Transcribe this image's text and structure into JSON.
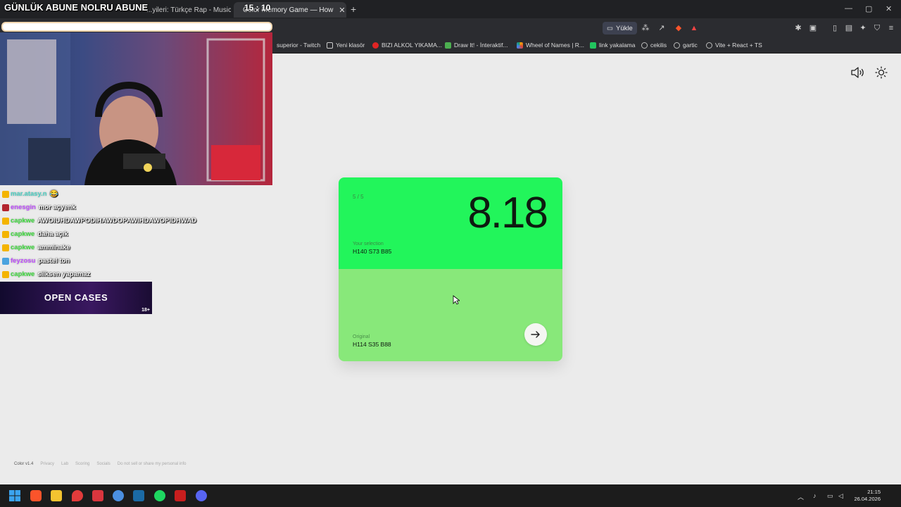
{
  "browser": {
    "tabs": [
      {
        "label": "...yileri: Türkçe Rap - Music Quiz - (",
        "active": false
      },
      {
        "label": "Color Memory Game — How",
        "active": true
      }
    ],
    "new_tab": "+",
    "window_controls": {
      "minimize": "—",
      "maximize": "▢",
      "close": "✕"
    },
    "toolbar": {
      "upload_label": "Yükle"
    },
    "bookmarks": [
      {
        "label": "superior - Twitch",
        "color": "#9146ff"
      },
      {
        "label": "Yeni klasör",
        "color": "#cccccc"
      },
      {
        "label": "BIZI ALKOL YIKAMA...",
        "color": "#e02424"
      },
      {
        "label": "Draw It! - İnteraktif...",
        "color": "#4caf50"
      },
      {
        "label": "Wheel of Names | R...",
        "color": "#f4b400"
      },
      {
        "label": "link yakalama",
        "color": "#22c55e"
      },
      {
        "label": "cekilis",
        "color": "#999999"
      },
      {
        "label": "gartic",
        "color": "#999999"
      },
      {
        "label": "Vite + React + TS",
        "color": "#999999"
      }
    ]
  },
  "game": {
    "round_counter": "5 / 5",
    "score": "8.18",
    "selection_label": "Your selection",
    "selection_value": "H140 S73 B85",
    "original_label": "Original",
    "original_value": "H114 S35 B88",
    "selection_color": "#22f55b",
    "original_color": "#88e87a",
    "footer": [
      "Color v1.4",
      "Privacy",
      "Lab",
      "Scoring",
      "Socials",
      "Do not sell or share my personal info"
    ]
  },
  "overlay": {
    "title": "GÜNLÜK ABUNE NOLRU ABUNE",
    "timer": "15 : 10",
    "chat": [
      {
        "user": "mar.atasy.n",
        "message": "😂",
        "color": "#4dd0c4"
      },
      {
        "user": "enesgin",
        "message": "mor açyenk",
        "color": "#c04dff"
      },
      {
        "user": "capkwe",
        "message": "AWOIUHDAWPODIHAWDOPAWIHDAWOPIDHWAD",
        "color": "#3ddc3d"
      },
      {
        "user": "capkwe",
        "message": "daha açık",
        "color": "#3ddc3d"
      },
      {
        "user": "capkwe",
        "message": "amminake",
        "color": "#3ddc3d"
      },
      {
        "user": "feyzosu",
        "message": "pastel ton",
        "color": "#c04dff"
      },
      {
        "user": "capkwe",
        "message": "silksen yapamaz",
        "color": "#3ddc3d"
      }
    ],
    "promo": {
      "text": "OPEN CASES",
      "age": "18+"
    }
  },
  "taskbar": {
    "time": "21:15",
    "date": "26.04.2026"
  }
}
